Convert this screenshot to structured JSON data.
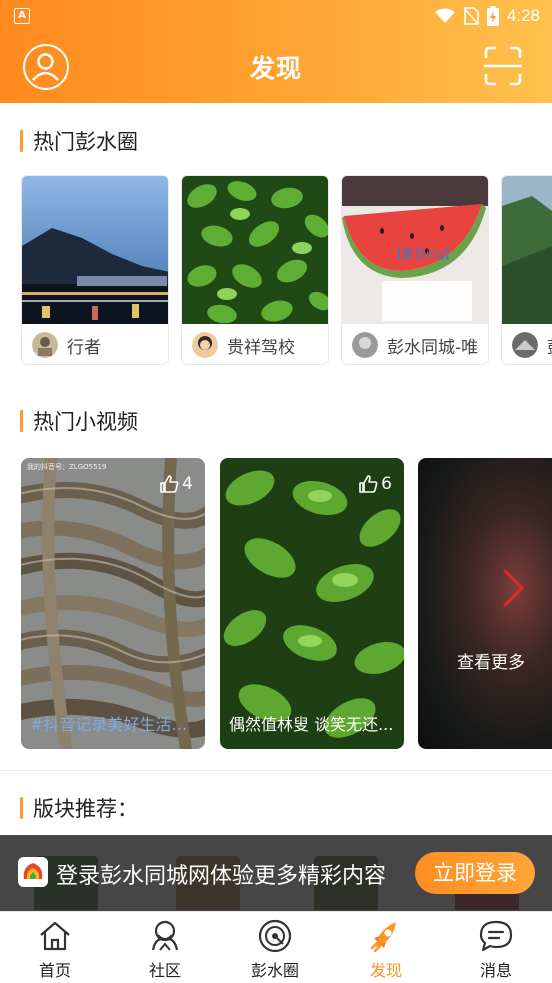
{
  "status": {
    "time": "4:28",
    "app_icon_letter": "A"
  },
  "header": {
    "title": "发现",
    "avatar_icon": "user-avatar-icon",
    "scan_icon": "scan-icon"
  },
  "sections": {
    "hot_circles": "热门彭水圈",
    "hot_videos": "热门小视频",
    "recommend": "版块推荐："
  },
  "circles": [
    {
      "name": "行者"
    },
    {
      "name": "贵祥驾校"
    },
    {
      "name": "彭水同城-唯",
      "thumb_text": "【夏日ing】"
    },
    {
      "name": "彭"
    }
  ],
  "videos": [
    {
      "likes": "4",
      "caption": "#抖音记录美好生活，...",
      "watermark": "我的抖音号：ZLGO5519"
    },
    {
      "likes": "6",
      "caption": "偶然值林叟 谈笑无还..."
    }
  ],
  "more_label": "查看更多",
  "login_banner": {
    "text": "登录彭水同城网体验更多精彩内容",
    "button": "立即登录"
  },
  "tabs": [
    {
      "label": "首页",
      "icon": "home-icon"
    },
    {
      "label": "社区",
      "icon": "community-icon"
    },
    {
      "label": "彭水圈",
      "icon": "circle-icon"
    },
    {
      "label": "发现",
      "icon": "discover-rocket-icon",
      "active": true
    },
    {
      "label": "消息",
      "icon": "message-icon"
    }
  ],
  "colors": {
    "accent": "#ff9424",
    "header_start": "#ff8a1f",
    "header_end": "#ffc14d",
    "banner_bg": "#282828"
  }
}
